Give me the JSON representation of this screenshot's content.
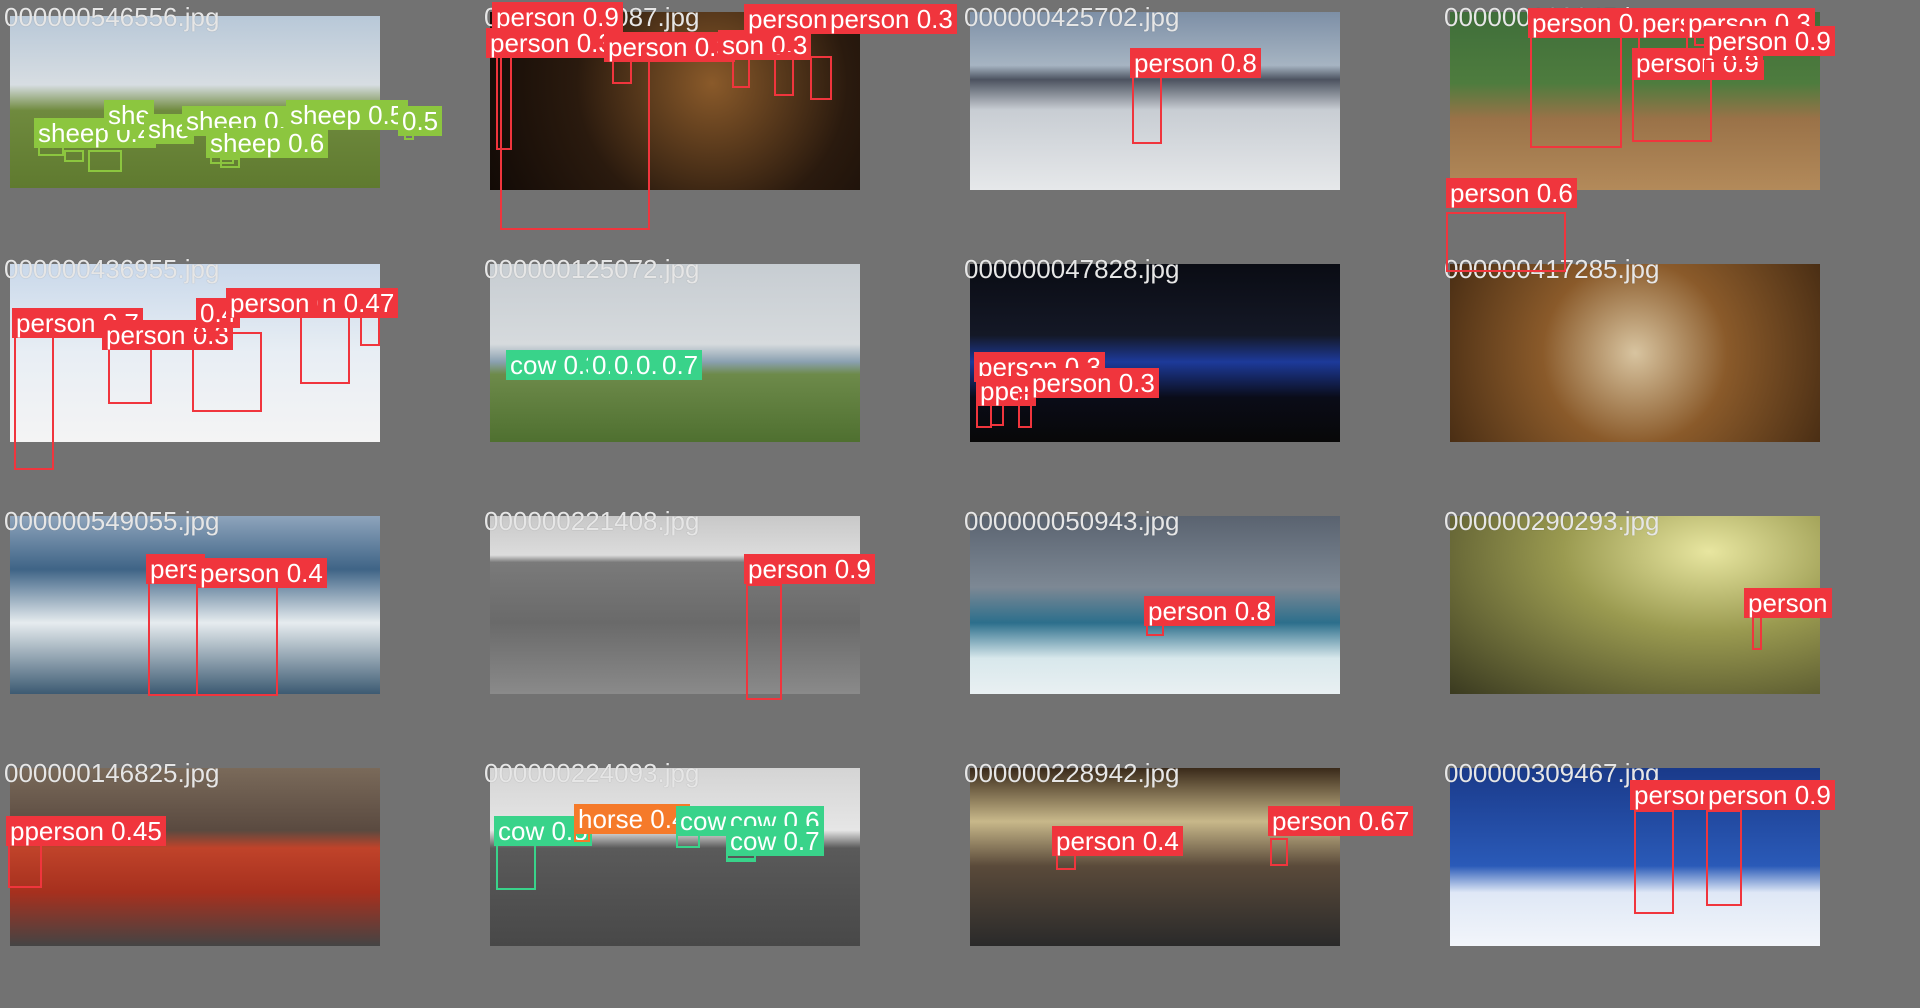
{
  "colors": {
    "person": "#f0353d",
    "sheep": "#8cc63f",
    "cow": "#39d38a",
    "horse": "#f57a2a",
    "caption": "#e6e6e6",
    "background": "#727272"
  },
  "tiles": [
    {
      "filename": "000000546556.jpg",
      "scene": "field-with-trees",
      "detections": [
        {
          "label": "sheep 0.4",
          "cls": "sheep"
        },
        {
          "label": "she",
          "cls": "sheep"
        },
        {
          "label": "she",
          "cls": "sheep"
        },
        {
          "label": "sheep 0.5",
          "cls": "sheep"
        },
        {
          "label": "sheep 0.5",
          "cls": "sheep"
        },
        {
          "label": "sheep 0.6",
          "cls": "sheep"
        },
        {
          "label": "0.5",
          "cls": "sheep"
        }
      ]
    },
    {
      "filename": "000000525087.jpg",
      "scene": "night-cafe",
      "detections": [
        {
          "label": "person 0.9",
          "cls": "person"
        },
        {
          "label": "person 0.3",
          "cls": "person"
        },
        {
          "label": "person 0.3",
          "cls": "person"
        },
        {
          "label": "son 0.3",
          "cls": "person"
        },
        {
          "label": "person 0.9",
          "cls": "person"
        },
        {
          "label": "person 0.3",
          "cls": "person"
        }
      ]
    },
    {
      "filename": "000000425702.jpg",
      "scene": "beach-surfer",
      "detections": [
        {
          "label": "person 0.8",
          "cls": "person"
        }
      ]
    },
    {
      "filename": "000000120345.jpg",
      "scene": "baseball",
      "detections": [
        {
          "label": "person 0.9",
          "cls": "person"
        },
        {
          "label": "person",
          "cls": "person"
        },
        {
          "label": "person 0.3",
          "cls": "person"
        },
        {
          "label": "person 0.9",
          "cls": "person"
        },
        {
          "label": "person 0.9",
          "cls": "person"
        },
        {
          "label": "person 0.6",
          "cls": "person"
        }
      ]
    },
    {
      "filename": "000000436955.jpg",
      "scene": "ski-race",
      "detections": [
        {
          "label": "person 0.7",
          "cls": "person"
        },
        {
          "label": "person 0.3",
          "cls": "person"
        },
        {
          "label": "0.4",
          "cls": "person"
        },
        {
          "label": "person 0.3",
          "cls": "person"
        },
        {
          "label": "n 0.47",
          "cls": "person"
        }
      ]
    },
    {
      "filename": "000000125072.jpg",
      "scene": "coastal-field",
      "detections": [
        {
          "label": "cow 0.3",
          "cls": "cow"
        },
        {
          "label": "0.4",
          "cls": "cow"
        },
        {
          "label": "0.5",
          "cls": "cow"
        },
        {
          "label": "0.7",
          "cls": "cow"
        },
        {
          "label": "0.7",
          "cls": "cow"
        }
      ]
    },
    {
      "filename": "000000047828.jpg",
      "scene": "night-bridge",
      "detections": [
        {
          "label": "person 0.3",
          "cls": "person"
        },
        {
          "label": "pper",
          "cls": "person"
        },
        {
          "label": "person 0.3",
          "cls": "person"
        }
      ]
    },
    {
      "filename": "000000417285.jpg",
      "scene": "coffee-pastries",
      "detections": []
    },
    {
      "filename": "000000549055.jpg",
      "scene": "wave-surfer",
      "detections": [
        {
          "label": "pers",
          "cls": "person"
        },
        {
          "label": "person 0.4",
          "cls": "person"
        }
      ]
    },
    {
      "filename": "000000221408.jpg",
      "scene": "paddleboard-bw",
      "detections": [
        {
          "label": "person 0.9",
          "cls": "person"
        }
      ]
    },
    {
      "filename": "000000050943.jpg",
      "scene": "big-wave",
      "detections": [
        {
          "label": "person 0.8",
          "cls": "person"
        }
      ]
    },
    {
      "filename": "000000290293.jpg",
      "scene": "subway-station",
      "detections": [
        {
          "label": "person",
          "cls": "person"
        }
      ]
    },
    {
      "filename": "000000146825.jpg",
      "scene": "train",
      "detections": [
        {
          "label": "pperson 0.45",
          "cls": "person"
        }
      ]
    },
    {
      "filename": "000000224093.jpg",
      "scene": "pasture-bw",
      "detections": [
        {
          "label": "cow 0.5",
          "cls": "cow"
        },
        {
          "label": "horse 0.4",
          "cls": "horse"
        },
        {
          "label": "cow",
          "cls": "cow"
        },
        {
          "label": "cow 0.6",
          "cls": "cow"
        },
        {
          "label": "cow 0.7",
          "cls": "cow"
        }
      ]
    },
    {
      "filename": "000000228942.jpg",
      "scene": "night-street",
      "detections": [
        {
          "label": "person 0.4",
          "cls": "person"
        },
        {
          "label": "person 0.67",
          "cls": "person"
        }
      ]
    },
    {
      "filename": "000000309467.jpg",
      "scene": "ski-slope",
      "detections": [
        {
          "label": "person",
          "cls": "person"
        },
        {
          "label": "person 0.9",
          "cls": "person"
        }
      ]
    }
  ]
}
